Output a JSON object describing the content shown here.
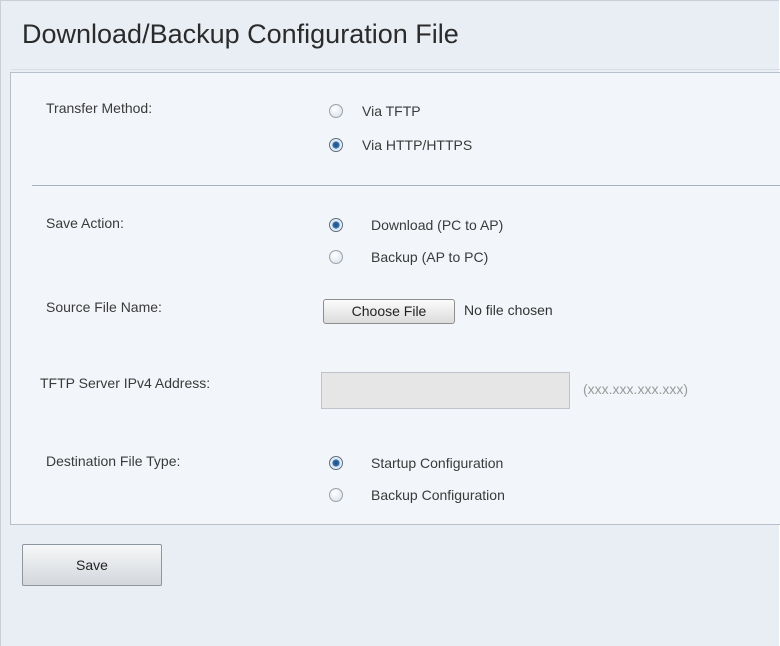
{
  "page": {
    "title": "Download/Backup Configuration File"
  },
  "transfer_method": {
    "label": "Transfer Method:",
    "options": [
      {
        "label": "Via TFTP",
        "checked": false
      },
      {
        "label": "Via HTTP/HTTPS",
        "checked": true
      }
    ]
  },
  "save_action": {
    "label": "Save Action:",
    "options": [
      {
        "label": "Download (PC to AP)",
        "checked": true
      },
      {
        "label": "Backup (AP to PC)",
        "checked": false
      }
    ]
  },
  "source_file": {
    "label": "Source File Name:",
    "button_label": "Choose File",
    "status": "No file chosen"
  },
  "tftp_server": {
    "label": "TFTP Server IPv4 Address:",
    "value": "",
    "hint": "(xxx.xxx.xxx.xxx)"
  },
  "destination_type": {
    "label": "Destination File Type:",
    "options": [
      {
        "label": "Startup Configuration",
        "checked": true
      },
      {
        "label": "Backup Configuration",
        "checked": false
      }
    ]
  },
  "actions": {
    "save_label": "Save"
  }
}
